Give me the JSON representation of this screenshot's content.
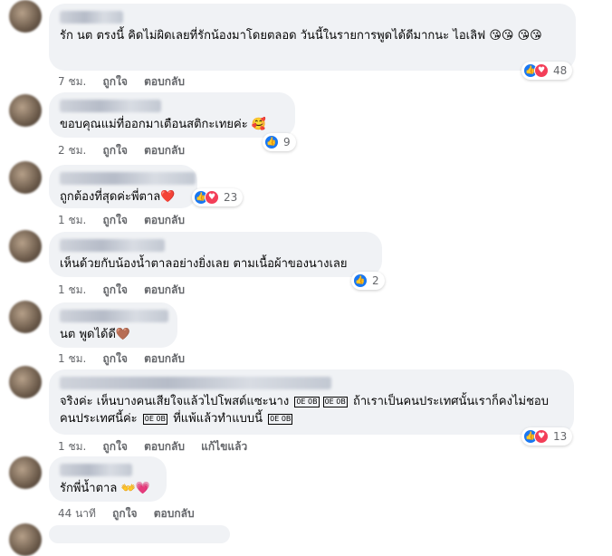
{
  "actions": {
    "like": "ถูกใจ",
    "reply": "ตอบกลับ",
    "edited": "แก้ไขแล้ว"
  },
  "comments": [
    {
      "text": "รัก นต ตรงนี้ คิดไม่ผิดเลยที่รักน้องมาโดยตลอด วันนี้ในรายการพูดได้ดีมากนะ ไอเลิฟ 😘😘 😘😘",
      "time": "7 ชม.",
      "reaction_count": "48",
      "reactions": [
        "like",
        "love"
      ]
    },
    {
      "text": "ขอบคุณแม่ที่ออกมาเตือนสติกะเทยค่ะ 🥰",
      "time": "2 ชม.",
      "reaction_count": "9",
      "reactions": [
        "like"
      ]
    },
    {
      "text": "ถูกต้องที่สุดค่ะพี่ตาล❤️",
      "time": "1 ชม.",
      "reaction_count": "23",
      "reactions": [
        "like",
        "love"
      ]
    },
    {
      "text": "เห็นด้วยกับน้องน้ำตาลอย่างยิ่งเลย ตามเนื้อผ้าของนางเลย",
      "time": "1 ชม.",
      "reaction_count": "2",
      "reactions": [
        "like"
      ]
    },
    {
      "text": "นต พูดได้ดี🤎",
      "time": "1 ชม.",
      "reaction_count": "",
      "reactions": []
    },
    {
      "text_a": "จริงค่ะ เห็นบางคนเสียใจแล้วไปโพสต์แซะนาง",
      "text_b": "ถ้าเราเป็นคนประเทศนั้นเราก็คงไม่ชอบ",
      "text_c": "คนประเทศนี้ค่ะ",
      "text_d": "ที่แพ้แล้วทำแบบนี้",
      "box_a": "0E\n0B",
      "box_b": "0E\n0B",
      "box_c": "0E\n0B",
      "box_d": "0E\n0B",
      "time": "1 ชม.",
      "reaction_count": "13",
      "reactions": [
        "like",
        "love"
      ]
    },
    {
      "text": "รักพี่น้ำตาล 👐💗",
      "time": "44 นาที",
      "reaction_count": "",
      "reactions": []
    }
  ]
}
